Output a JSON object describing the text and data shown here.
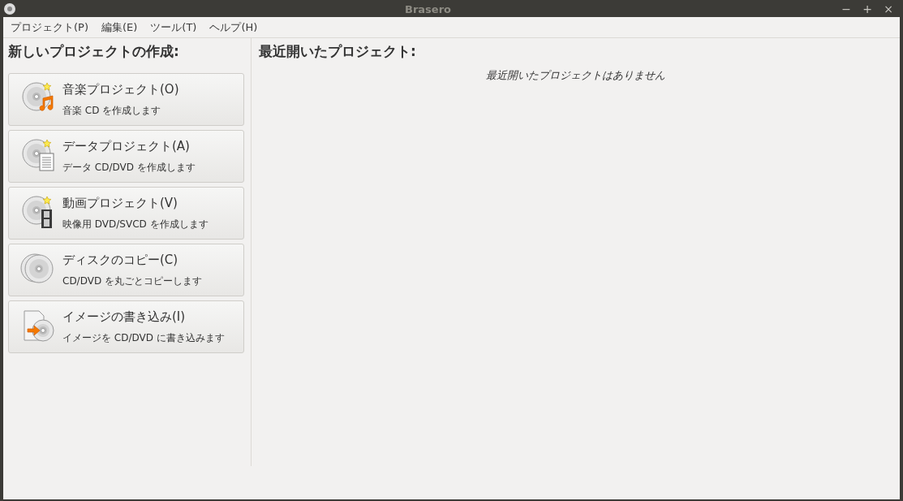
{
  "window": {
    "title": "Brasero",
    "controls": [
      "−",
      "+",
      "×"
    ]
  },
  "menu": [
    "プロジェクト(P)",
    "編集(E)",
    "ツール(T)",
    "ヘルプ(H)"
  ],
  "new_project": {
    "heading": "新しいプロジェクトの作成:",
    "items": [
      {
        "kind": "audio",
        "title": "音楽プロジェクト(O)",
        "subtitle": "音楽 CD を作成します"
      },
      {
        "kind": "data",
        "title": "データプロジェクト(A)",
        "subtitle": "データ CD/DVD を作成します"
      },
      {
        "kind": "video",
        "title": "動画プロジェクト(V)",
        "subtitle": "映像用 DVD/SVCD を作成します"
      },
      {
        "kind": "copy",
        "title": "ディスクのコピー(C)",
        "subtitle": "CD/DVD を丸ごとコピーします"
      },
      {
        "kind": "image",
        "title": "イメージの書き込み(I)",
        "subtitle": "イメージを CD/DVD に書き込みます"
      }
    ]
  },
  "recent": {
    "heading": "最近開いたプロジェクト:",
    "empty_message": "最近開いたプロジェクトはありません"
  }
}
